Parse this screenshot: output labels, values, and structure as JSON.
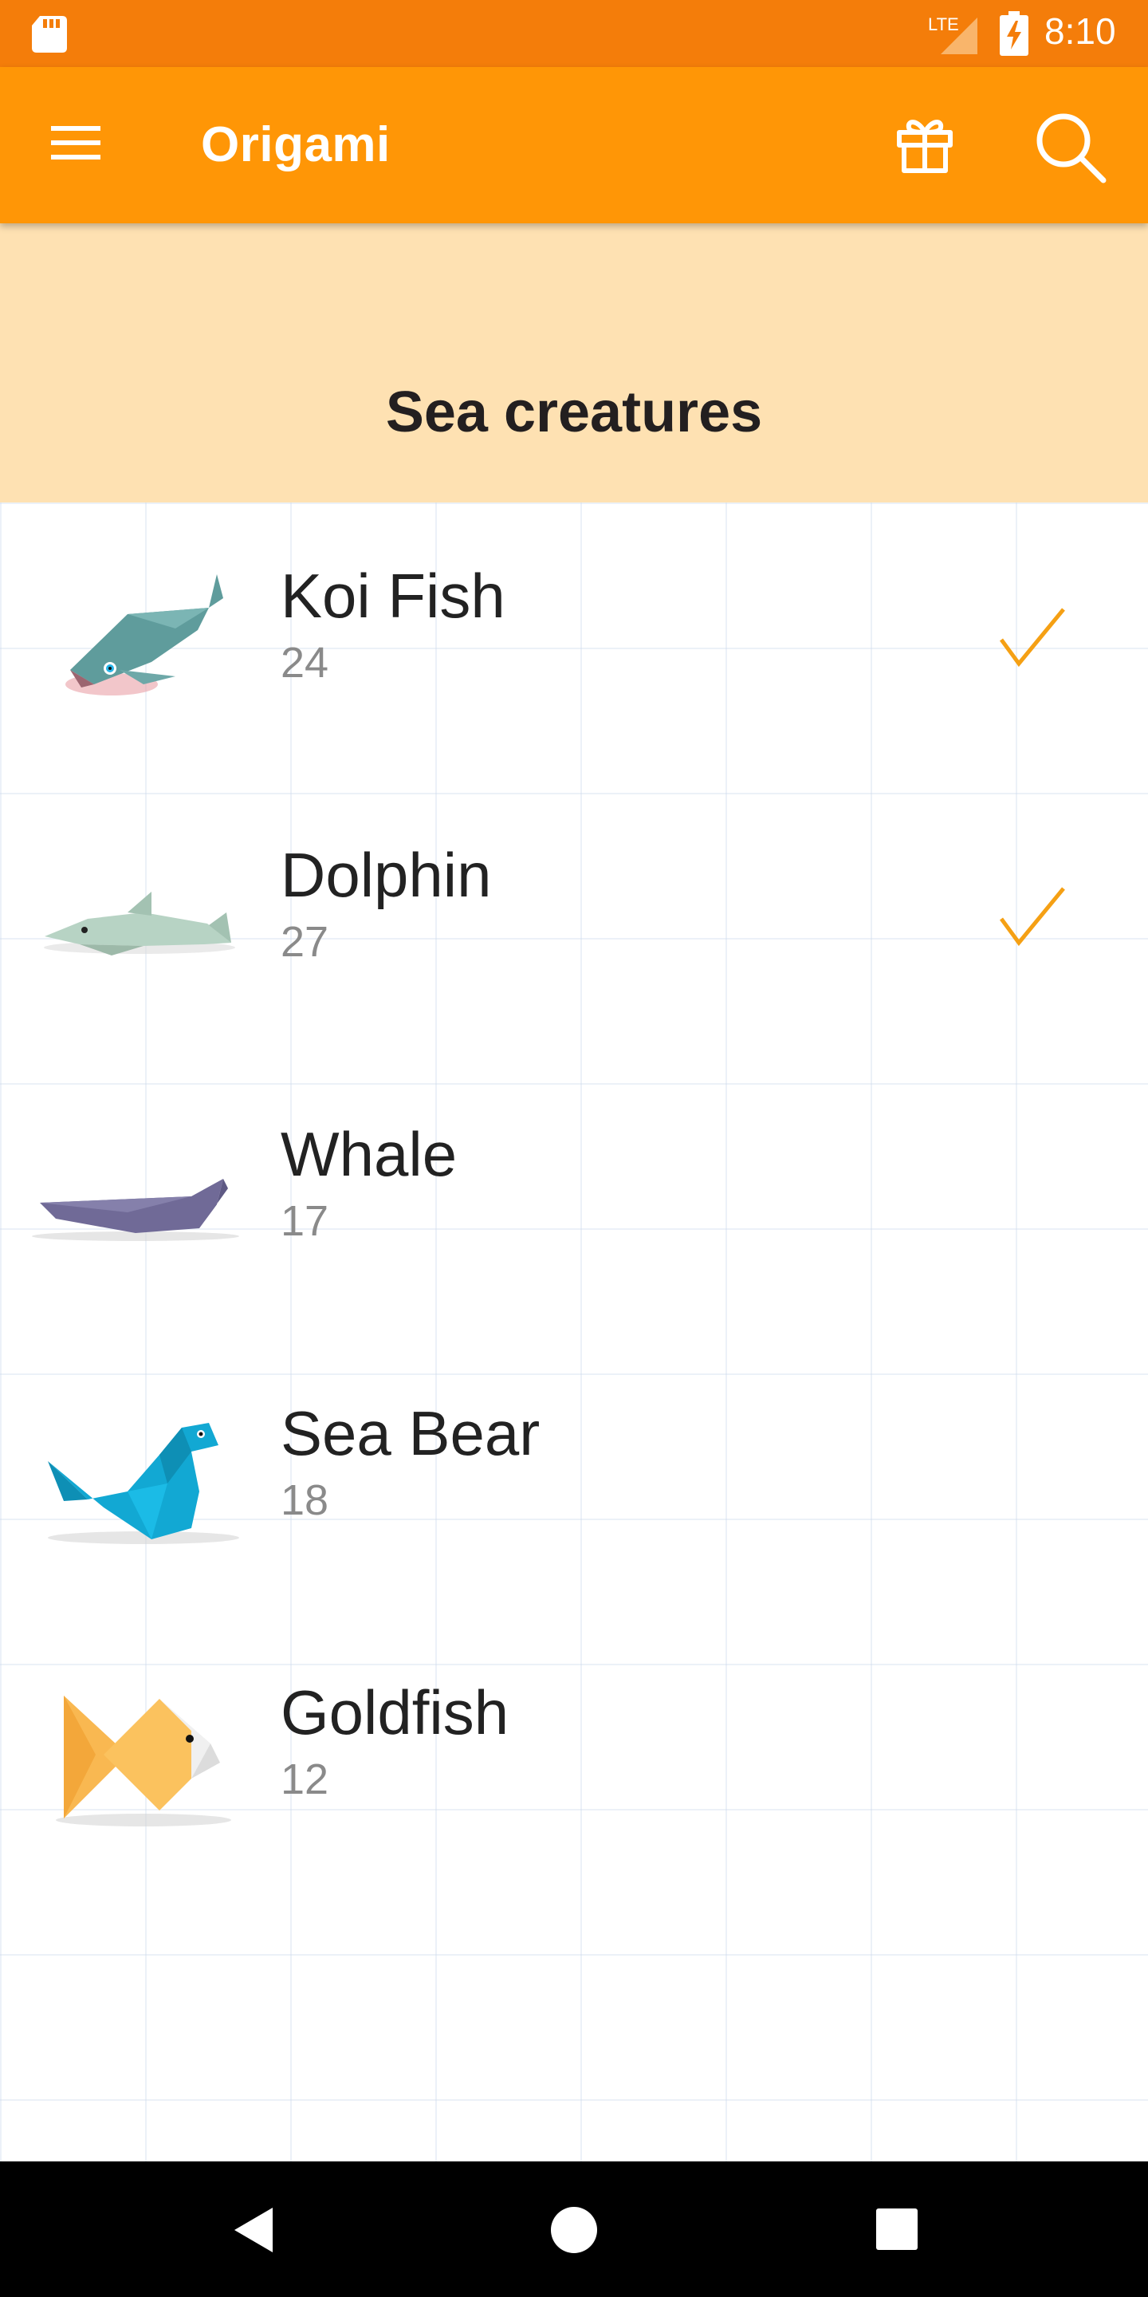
{
  "status_bar": {
    "time": "8:10",
    "network": "LTE",
    "icons": [
      "sd-card-icon",
      "signal-icon",
      "battery-charging-icon"
    ]
  },
  "app_bar": {
    "title": "Origami",
    "icons": [
      "menu-icon",
      "gift-icon",
      "search-icon"
    ]
  },
  "category": {
    "title": "Sea creatures"
  },
  "items": [
    {
      "name": "Koi Fish",
      "count": "24",
      "completed": true,
      "icon": "koi-fish-icon"
    },
    {
      "name": "Dolphin",
      "count": "27",
      "completed": true,
      "icon": "dolphin-icon"
    },
    {
      "name": "Whale",
      "count": "17",
      "completed": false,
      "icon": "whale-icon"
    },
    {
      "name": "Sea Bear",
      "count": "18",
      "completed": false,
      "icon": "sea-bear-icon"
    },
    {
      "name": "Goldfish",
      "count": "12",
      "completed": false,
      "icon": "goldfish-icon"
    }
  ],
  "colors": {
    "status_bar": "#f47d0a",
    "app_bar": "#ff9606",
    "header_bg": "#fee1b2",
    "check": "#f5a014",
    "nav_bar": "#000000"
  },
  "nav_bar": {
    "icons": [
      "back-icon",
      "home-icon",
      "recent-apps-icon"
    ]
  }
}
